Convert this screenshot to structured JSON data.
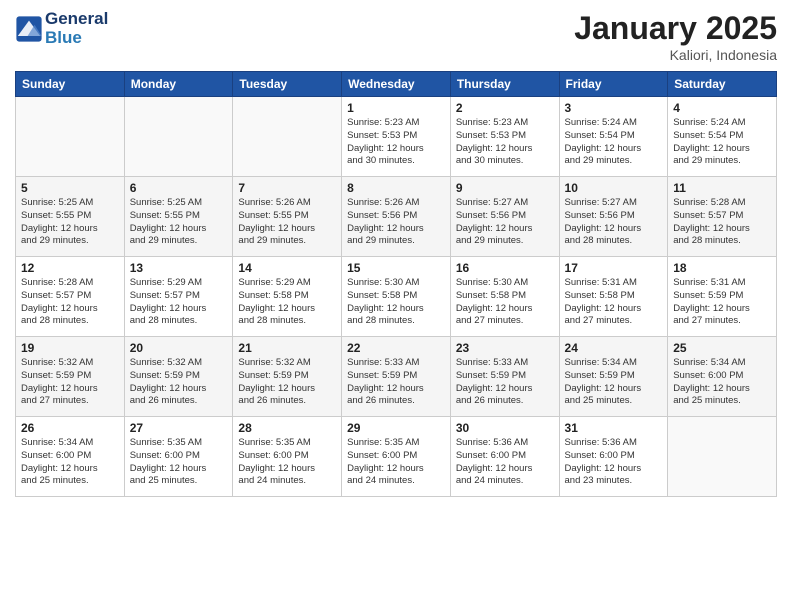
{
  "logo": {
    "line1": "General",
    "line2": "Blue"
  },
  "title": "January 2025",
  "location": "Kaliori, Indonesia",
  "days_of_week": [
    "Sunday",
    "Monday",
    "Tuesday",
    "Wednesday",
    "Thursday",
    "Friday",
    "Saturday"
  ],
  "weeks": [
    [
      {
        "day": "",
        "info": ""
      },
      {
        "day": "",
        "info": ""
      },
      {
        "day": "",
        "info": ""
      },
      {
        "day": "1",
        "info": "Sunrise: 5:23 AM\nSunset: 5:53 PM\nDaylight: 12 hours\nand 30 minutes."
      },
      {
        "day": "2",
        "info": "Sunrise: 5:23 AM\nSunset: 5:53 PM\nDaylight: 12 hours\nand 30 minutes."
      },
      {
        "day": "3",
        "info": "Sunrise: 5:24 AM\nSunset: 5:54 PM\nDaylight: 12 hours\nand 29 minutes."
      },
      {
        "day": "4",
        "info": "Sunrise: 5:24 AM\nSunset: 5:54 PM\nDaylight: 12 hours\nand 29 minutes."
      }
    ],
    [
      {
        "day": "5",
        "info": "Sunrise: 5:25 AM\nSunset: 5:55 PM\nDaylight: 12 hours\nand 29 minutes."
      },
      {
        "day": "6",
        "info": "Sunrise: 5:25 AM\nSunset: 5:55 PM\nDaylight: 12 hours\nand 29 minutes."
      },
      {
        "day": "7",
        "info": "Sunrise: 5:26 AM\nSunset: 5:55 PM\nDaylight: 12 hours\nand 29 minutes."
      },
      {
        "day": "8",
        "info": "Sunrise: 5:26 AM\nSunset: 5:56 PM\nDaylight: 12 hours\nand 29 minutes."
      },
      {
        "day": "9",
        "info": "Sunrise: 5:27 AM\nSunset: 5:56 PM\nDaylight: 12 hours\nand 29 minutes."
      },
      {
        "day": "10",
        "info": "Sunrise: 5:27 AM\nSunset: 5:56 PM\nDaylight: 12 hours\nand 28 minutes."
      },
      {
        "day": "11",
        "info": "Sunrise: 5:28 AM\nSunset: 5:57 PM\nDaylight: 12 hours\nand 28 minutes."
      }
    ],
    [
      {
        "day": "12",
        "info": "Sunrise: 5:28 AM\nSunset: 5:57 PM\nDaylight: 12 hours\nand 28 minutes."
      },
      {
        "day": "13",
        "info": "Sunrise: 5:29 AM\nSunset: 5:57 PM\nDaylight: 12 hours\nand 28 minutes."
      },
      {
        "day": "14",
        "info": "Sunrise: 5:29 AM\nSunset: 5:58 PM\nDaylight: 12 hours\nand 28 minutes."
      },
      {
        "day": "15",
        "info": "Sunrise: 5:30 AM\nSunset: 5:58 PM\nDaylight: 12 hours\nand 28 minutes."
      },
      {
        "day": "16",
        "info": "Sunrise: 5:30 AM\nSunset: 5:58 PM\nDaylight: 12 hours\nand 27 minutes."
      },
      {
        "day": "17",
        "info": "Sunrise: 5:31 AM\nSunset: 5:58 PM\nDaylight: 12 hours\nand 27 minutes."
      },
      {
        "day": "18",
        "info": "Sunrise: 5:31 AM\nSunset: 5:59 PM\nDaylight: 12 hours\nand 27 minutes."
      }
    ],
    [
      {
        "day": "19",
        "info": "Sunrise: 5:32 AM\nSunset: 5:59 PM\nDaylight: 12 hours\nand 27 minutes."
      },
      {
        "day": "20",
        "info": "Sunrise: 5:32 AM\nSunset: 5:59 PM\nDaylight: 12 hours\nand 26 minutes."
      },
      {
        "day": "21",
        "info": "Sunrise: 5:32 AM\nSunset: 5:59 PM\nDaylight: 12 hours\nand 26 minutes."
      },
      {
        "day": "22",
        "info": "Sunrise: 5:33 AM\nSunset: 5:59 PM\nDaylight: 12 hours\nand 26 minutes."
      },
      {
        "day": "23",
        "info": "Sunrise: 5:33 AM\nSunset: 5:59 PM\nDaylight: 12 hours\nand 26 minutes."
      },
      {
        "day": "24",
        "info": "Sunrise: 5:34 AM\nSunset: 5:59 PM\nDaylight: 12 hours\nand 25 minutes."
      },
      {
        "day": "25",
        "info": "Sunrise: 5:34 AM\nSunset: 6:00 PM\nDaylight: 12 hours\nand 25 minutes."
      }
    ],
    [
      {
        "day": "26",
        "info": "Sunrise: 5:34 AM\nSunset: 6:00 PM\nDaylight: 12 hours\nand 25 minutes."
      },
      {
        "day": "27",
        "info": "Sunrise: 5:35 AM\nSunset: 6:00 PM\nDaylight: 12 hours\nand 25 minutes."
      },
      {
        "day": "28",
        "info": "Sunrise: 5:35 AM\nSunset: 6:00 PM\nDaylight: 12 hours\nand 24 minutes."
      },
      {
        "day": "29",
        "info": "Sunrise: 5:35 AM\nSunset: 6:00 PM\nDaylight: 12 hours\nand 24 minutes."
      },
      {
        "day": "30",
        "info": "Sunrise: 5:36 AM\nSunset: 6:00 PM\nDaylight: 12 hours\nand 24 minutes."
      },
      {
        "day": "31",
        "info": "Sunrise: 5:36 AM\nSunset: 6:00 PM\nDaylight: 12 hours\nand 23 minutes."
      },
      {
        "day": "",
        "info": ""
      }
    ]
  ]
}
